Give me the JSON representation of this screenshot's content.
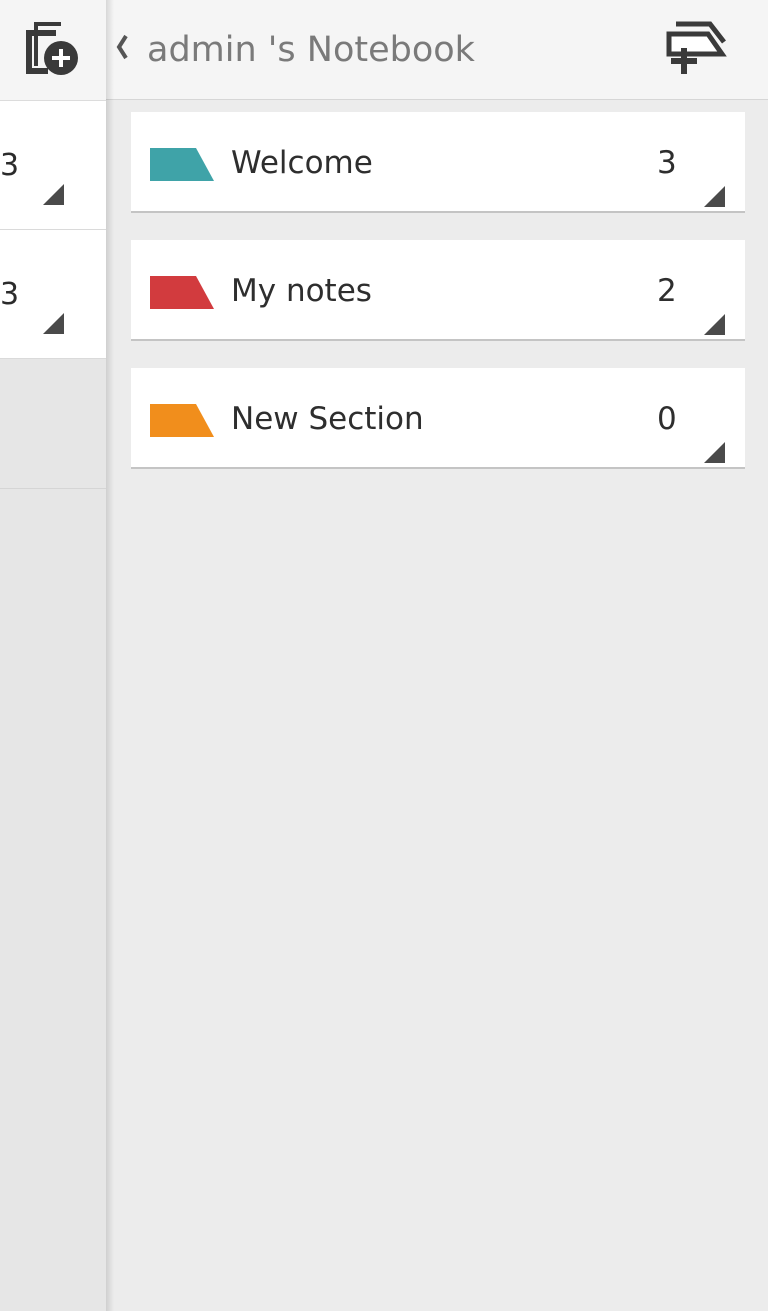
{
  "header": {
    "title": "admin 's Notebook",
    "back_icon": "chevron-left-icon",
    "add_section_icon": "add-section-icon"
  },
  "left_pane": {
    "new_page_icon": "new-page-icon",
    "items": [
      {
        "count": "3"
      },
      {
        "count": "3"
      }
    ]
  },
  "sections": [
    {
      "name": "Welcome",
      "count": "3",
      "color": "#3fa3a8"
    },
    {
      "name": "My notes",
      "count": "2",
      "color": "#d23b3e"
    },
    {
      "name": "New Section",
      "count": "0",
      "color": "#f18e1c"
    }
  ],
  "colors": {
    "background": "#ececec",
    "card": "#ffffff",
    "header": "#f5f5f5",
    "icon": "#3a3a3a"
  }
}
